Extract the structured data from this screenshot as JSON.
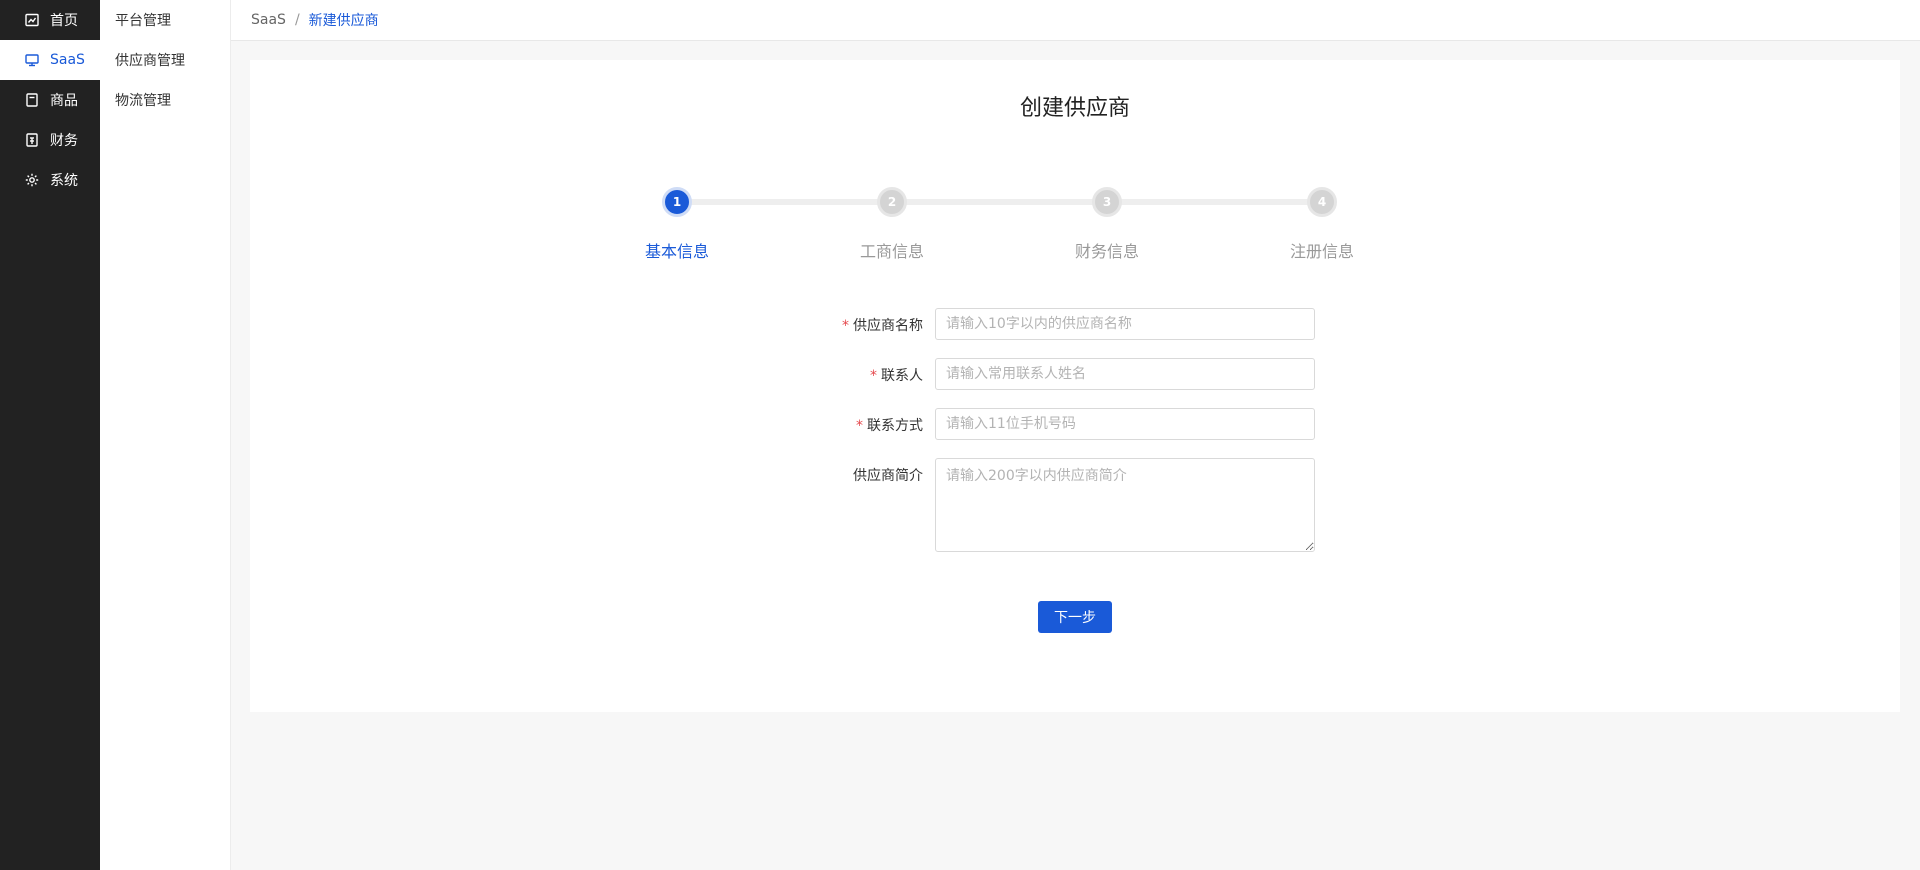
{
  "sidebar": {
    "items": [
      {
        "label": "首页",
        "icon": "home-icon"
      },
      {
        "label": "SaaS",
        "icon": "monitor-icon"
      },
      {
        "label": "商品",
        "icon": "product-icon"
      },
      {
        "label": "财务",
        "icon": "finance-icon"
      },
      {
        "label": "系统",
        "icon": "gear-icon"
      }
    ],
    "active_index": 1
  },
  "subnav": {
    "items": [
      {
        "label": "平台管理"
      },
      {
        "label": "供应商管理"
      },
      {
        "label": "物流管理"
      }
    ]
  },
  "breadcrumb": {
    "root": "SaaS",
    "separator": "/",
    "current": "新建供应商"
  },
  "page": {
    "title": "创建供应商"
  },
  "steps": {
    "items": [
      {
        "number": "1",
        "label": "基本信息"
      },
      {
        "number": "2",
        "label": "工商信息"
      },
      {
        "number": "3",
        "label": "财务信息"
      },
      {
        "number": "4",
        "label": "注册信息"
      }
    ],
    "current": 1
  },
  "form": {
    "supplier_name": {
      "label": "供应商名称",
      "required_mark": "*",
      "placeholder": "请输入10字以内的供应商名称",
      "value": ""
    },
    "contact_person": {
      "label": "联系人",
      "required_mark": "*",
      "placeholder": "请输入常用联系人姓名",
      "value": ""
    },
    "contact_method": {
      "label": "联系方式",
      "required_mark": "*",
      "placeholder": "请输入11位手机号码",
      "value": ""
    },
    "supplier_intro": {
      "label": "供应商简介",
      "placeholder": "请输入200字以内供应商简介",
      "value": ""
    }
  },
  "actions": {
    "next_label": "下一步"
  },
  "colors": {
    "primary": "#1a5ad8",
    "sidebar_bg": "#222222",
    "required": "#e5484d",
    "step_inactive": "#d4d4d4"
  }
}
